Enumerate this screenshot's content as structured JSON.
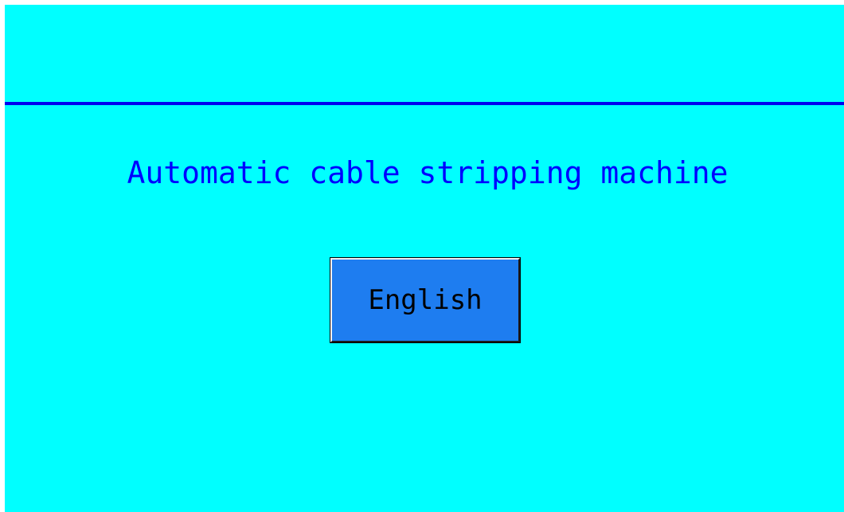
{
  "screen": {
    "background_color": "#00ffff",
    "divider_color": "#0000ee"
  },
  "title": {
    "text": "Automatic cable stripping machine",
    "color": "#0000ff"
  },
  "language_button": {
    "label": "English",
    "background_color": "#1e7df0"
  }
}
